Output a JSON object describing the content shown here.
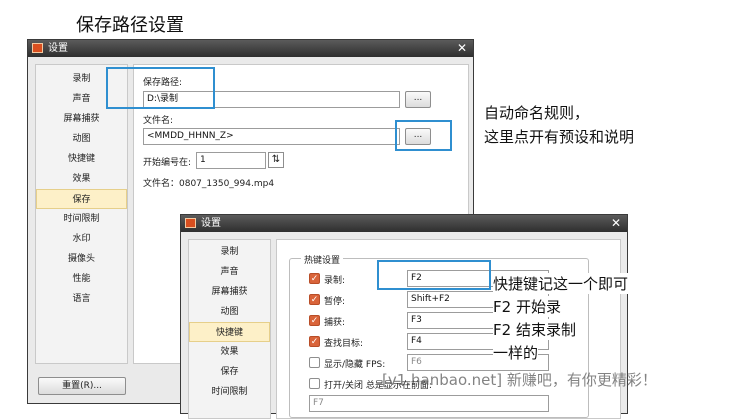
{
  "annotations": {
    "top_title": "保存路径设置",
    "note1_line1": "自动命名规则，",
    "note1_line2": "这里点开有预设和说明",
    "note2_line1": "快捷键记这一个即可",
    "note2_line2": "F2 开始录",
    "note2_line3": "F2 结束录制",
    "note2_line4": "一样的",
    "watermark": "[v1.hanbao.net] 新赚吧，有你更精彩！"
  },
  "dialog_save": {
    "title": "设置",
    "close_icon": "close-icon",
    "sidebar": [
      "录制",
      "声音",
      "屏幕捕获",
      "动图",
      "快捷键",
      "效果",
      "保存",
      "时间限制",
      "水印",
      "摄像头",
      "性能",
      "语言"
    ],
    "selected_index": 6,
    "save_path_label": "保存路径:",
    "save_path_value": "D:\\录制",
    "browse_label": "...",
    "filename_label": "文件名:",
    "filename_value": "<MMDD_HHNN_Z>",
    "start_number_label": "开始编号在:",
    "start_number_value": "1",
    "filename_preview": "文件名：0807_1350_994.mp4",
    "reset_button": "重置(R)..."
  },
  "dialog_hotkey": {
    "title": "设置",
    "close_icon": "close-icon",
    "sidebar": [
      "录制",
      "声音",
      "屏幕捕获",
      "动图",
      "快捷键",
      "效果",
      "保存",
      "时间限制"
    ],
    "selected_index": 4,
    "group_title": "热键设置",
    "hotkeys": [
      {
        "label": "录制:",
        "value": "F2",
        "checked": true
      },
      {
        "label": "暂停:",
        "value": "Shift+F2",
        "checked": true
      },
      {
        "label": "捕获:",
        "value": "F3",
        "checked": true
      },
      {
        "label": "查找目标:",
        "value": "F4",
        "checked": true
      },
      {
        "label": "显示/隐藏 FPS:",
        "value": "F6",
        "checked": false
      },
      {
        "label": "打开/关闭 总是显示在前面:",
        "value": "F7",
        "checked": false
      }
    ]
  },
  "colors": {
    "highlight": "#2f8fd0",
    "checkbox_on": "#d9643a",
    "selected_item": "#fdf0c8"
  }
}
